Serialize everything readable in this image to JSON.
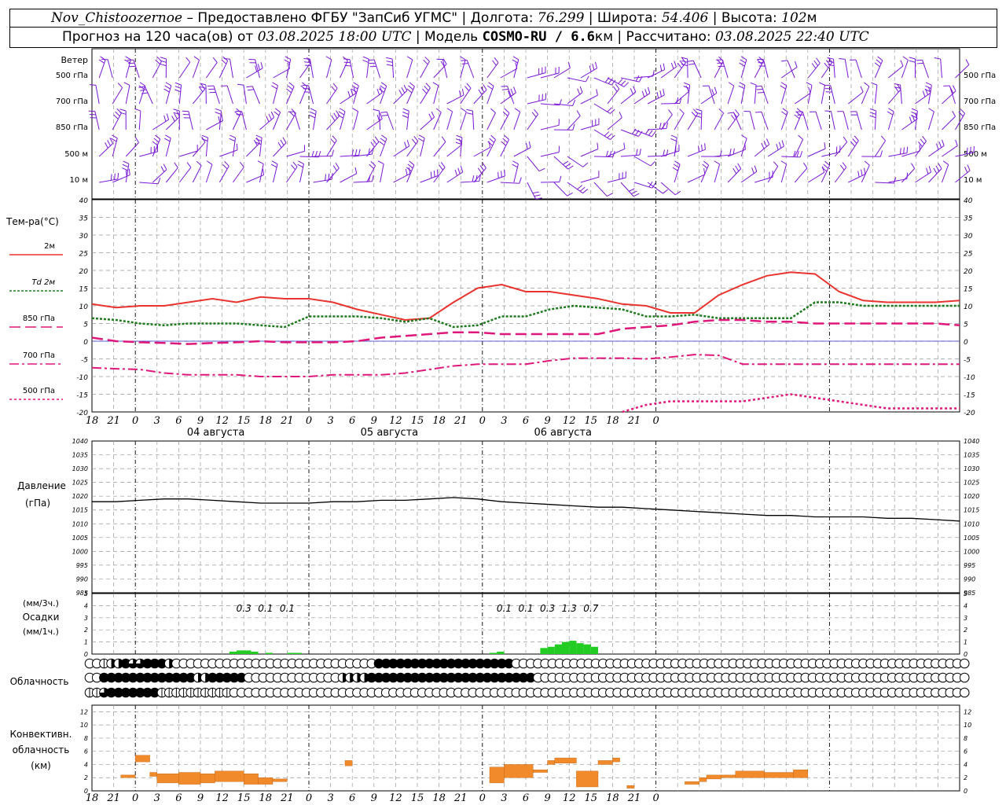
{
  "header": {
    "station": "Nov_Chistoozernoe",
    "provider": "– Предоставлено ФГБУ \"ЗапСиб УГМС\"",
    "lon_label": "| Долгота:",
    "lon_value": "76.299",
    "lat_label": "| Широта:",
    "lat_value": "54.406",
    "alt_label": "| Высота:",
    "alt_value": "102",
    "alt_unit": "м",
    "forecast_label": "Прогноз на 120 часа(ов) от",
    "forecast_start": "03.08.2025 18:00 UTC",
    "model_label": "| Модель",
    "model_name": "COSMO-RU / 6.6",
    "model_unit": "км",
    "calc_label": "| Рассчитано:",
    "calc_time": "03.08.2025 22:40 UTC"
  },
  "colors": {
    "wind": "#7a18d6",
    "t2m": "#e8332e",
    "td2m": "#1f7a1f",
    "t850": "#e0177a",
    "pressure": "#000000",
    "precip": "#22cc22",
    "conv": "#f08a2a"
  },
  "chart_data": [
    {
      "type": "wind_barbs",
      "panel_label": "Ветер",
      "levels": [
        "500 гПа",
        "700 гПа",
        "850 гПа",
        "500 м",
        "10  м"
      ],
      "x_time_labels": [
        "18",
        "21",
        "0",
        "3",
        "6",
        "9",
        "12",
        "15",
        "18",
        "21",
        "0",
        "3",
        "6",
        "9",
        "12",
        "15",
        "18",
        "21",
        "0",
        "3",
        "6",
        "9",
        "12",
        "15",
        "18",
        "21",
        "0"
      ]
    },
    {
      "type": "line",
      "title": "Тем-ра(°C)",
      "ylim": [
        -20,
        40
      ],
      "y_ticks": [
        "40",
        "35",
        "30",
        "25",
        "20",
        "15",
        "10",
        "5",
        "0",
        "-5",
        "-10",
        "-15",
        "-20"
      ],
      "x_labels": [
        "18",
        "21",
        "0",
        "3",
        "6",
        "9",
        "12",
        "15",
        "18",
        "21",
        "0",
        "3",
        "6",
        "9",
        "12",
        "15",
        "18",
        "21",
        "0",
        "3",
        "6",
        "9",
        "12",
        "15",
        "18",
        "21",
        "0"
      ],
      "date_labels": [
        "04 августа",
        "05 августа",
        "06 августа"
      ],
      "x_hours_step": 3,
      "series": [
        {
          "name": "2м",
          "key": "t2m",
          "values": [
            10.5,
            9.5,
            10,
            10,
            11,
            12,
            11,
            12.5,
            12,
            12,
            11,
            9,
            7.5,
            6,
            6.5,
            11,
            15,
            16,
            14,
            14,
            13,
            12,
            10.5,
            10,
            8,
            8,
            13,
            16,
            18.5,
            19.5,
            19,
            14,
            11.5,
            11,
            11,
            11,
            11.5
          ]
        },
        {
          "name": "Td 2м",
          "key": "td2m",
          "values": [
            6.5,
            6,
            5,
            4.5,
            5,
            5,
            5,
            4.5,
            4,
            7,
            7,
            7,
            6.5,
            5.5,
            6.5,
            4,
            4.5,
            7,
            7,
            9,
            10,
            9.5,
            9,
            7,
            7,
            7.5,
            6.5,
            6.5,
            6.5,
            6.5,
            11,
            11,
            10,
            10,
            10,
            10,
            10
          ]
        },
        {
          "name": "850 гПа",
          "key": "t850",
          "values": [
            1,
            0,
            -0.3,
            -0.5,
            -0.8,
            -0.5,
            -0.3,
            0,
            -0.3,
            -0.3,
            -0.3,
            0,
            1,
            1.5,
            2,
            2.5,
            2.5,
            2,
            2,
            2,
            2,
            2,
            3.5,
            4,
            4.5,
            5.5,
            6,
            6,
            5.5,
            5.5,
            5,
            5,
            5,
            5,
            5,
            5,
            4.5
          ]
        },
        {
          "name": "700 гПа",
          "key": "t700",
          "values": [
            -7.5,
            -7.8,
            -8,
            -9,
            -9.5,
            -9.5,
            -9.5,
            -10,
            -10,
            -10,
            -9.5,
            -9.5,
            -9.5,
            -9,
            -8,
            -7,
            -6.5,
            -6.5,
            -6.5,
            -5.5,
            -4.8,
            -4.8,
            -4.8,
            -5,
            -4.5,
            -3.8,
            -4,
            -6.5,
            -6.5,
            -6.5,
            -6.5,
            -6.5,
            -6.5,
            -6.5,
            -6.5,
            -6.5,
            -6.5
          ]
        },
        {
          "name": "500 гПа",
          "key": "t500",
          "values": [
            null,
            null,
            null,
            null,
            null,
            null,
            null,
            null,
            null,
            null,
            null,
            null,
            null,
            null,
            null,
            null,
            null,
            null,
            null,
            null,
            null,
            null,
            -20,
            -18,
            -17,
            -17,
            -17,
            -17,
            -16,
            -15,
            -16,
            -17,
            -18,
            -19,
            -19,
            -19,
            -19
          ]
        }
      ]
    },
    {
      "type": "line",
      "title": "Давление",
      "ylabel": "(гПа)",
      "ylim": [
        985,
        1040
      ],
      "y_ticks": [
        "1040",
        "1035",
        "1030",
        "1025",
        "1020",
        "1015",
        "1010",
        "1005",
        "1000",
        "995",
        "990",
        "985"
      ],
      "x_hours_step": 3,
      "series": [
        {
          "name": "Давление",
          "key": "pressure",
          "values": [
            1018,
            1018,
            1018.5,
            1019,
            1019,
            1018.5,
            1018,
            1017.5,
            1017.5,
            1017.5,
            1018,
            1018,
            1018.5,
            1018.5,
            1019,
            1019.5,
            1019,
            1018,
            1017.5,
            1017,
            1016.5,
            1016,
            1016,
            1015.5,
            1015,
            1014.5,
            1014,
            1013.5,
            1013,
            1013,
            1012.5,
            1012.5,
            1012.5,
            1012,
            1012,
            1011.5,
            1011
          ]
        }
      ]
    },
    {
      "type": "bar",
      "title": "Осадки",
      "ylabel_top": "(мм/3ч.)",
      "ylabel_bottom": "(мм/1ч.)",
      "ylim": [
        0,
        5
      ],
      "y_ticks": [
        "5",
        "4",
        "3",
        "2",
        "1",
        "0"
      ],
      "annotations": [
        {
          "hour": 21,
          "text": "0.3"
        },
        {
          "hour": 24,
          "text": "0.1"
        },
        {
          "hour": 27,
          "text": "0.1"
        },
        {
          "hour": 57,
          "text": "0.1"
        },
        {
          "hour": 60,
          "text": "0.1"
        },
        {
          "hour": 63,
          "text": "0.3"
        },
        {
          "hour": 66,
          "text": "1.3"
        },
        {
          "hour": 69,
          "text": "0.7"
        }
      ],
      "hourly_bars": [
        {
          "hour": 20,
          "value": 0.2
        },
        {
          "hour": 21,
          "value": 0.3
        },
        {
          "hour": 22,
          "value": 0.3
        },
        {
          "hour": 23,
          "value": 0.2
        },
        {
          "hour": 25,
          "value": 0.1
        },
        {
          "hour": 28,
          "value": 0.1
        },
        {
          "hour": 29,
          "value": 0.1
        },
        {
          "hour": 56,
          "value": 0.1
        },
        {
          "hour": 57,
          "value": 0.2
        },
        {
          "hour": 63,
          "value": 0.5
        },
        {
          "hour": 64,
          "value": 0.6
        },
        {
          "hour": 65,
          "value": 0.8
        },
        {
          "hour": 66,
          "value": 1.0
        },
        {
          "hour": 67,
          "value": 1.1
        },
        {
          "hour": 68,
          "value": 0.9
        },
        {
          "hour": 69,
          "value": 0.8
        },
        {
          "hour": 70,
          "value": 0.6
        }
      ]
    },
    {
      "type": "symbols",
      "title": "Облачность",
      "rows": [
        "00122433444200000000000000000000000000004444444444444444444000000000000000000000000000000000000000000000000000000000000000",
        "00444444444444422444440000000000000222244444444444444444444444000000000000000000000000000000000000000000000000000000000000",
        "11344444441111111111000000000000000000000000000000000000000000000000000000000000000000000000000000000000000000000000000000"
      ]
    },
    {
      "type": "bar",
      "title": "Конвективн. облачность (км)",
      "ylim": [
        0,
        13
      ],
      "y_ticks": [
        "12",
        "10",
        "8",
        "6",
        "4",
        "2",
        "0"
      ],
      "segments": [
        {
          "from": 4,
          "to": 6,
          "low": 2,
          "high": 2.4
        },
        {
          "from": 6,
          "to": 8,
          "low": 4.4,
          "high": 5.4
        },
        {
          "from": 8,
          "to": 9,
          "low": 2.2,
          "high": 2.8
        },
        {
          "from": 9,
          "to": 12,
          "low": 1.2,
          "high": 2.6
        },
        {
          "from": 12,
          "to": 15,
          "low": 1.0,
          "high": 2.8
        },
        {
          "from": 15,
          "to": 17,
          "low": 1.2,
          "high": 2.6
        },
        {
          "from": 17,
          "to": 21,
          "low": 1.4,
          "high": 3.0
        },
        {
          "from": 21,
          "to": 23,
          "low": 1.0,
          "high": 2.6
        },
        {
          "from": 23,
          "to": 25,
          "low": 1.0,
          "high": 2.0
        },
        {
          "from": 25,
          "to": 27,
          "low": 1.4,
          "high": 1.8
        },
        {
          "from": 35,
          "to": 36,
          "low": 3.8,
          "high": 4.6
        },
        {
          "from": 55,
          "to": 57,
          "low": 1.2,
          "high": 3.6
        },
        {
          "from": 57,
          "to": 61,
          "low": 2.0,
          "high": 4.0
        },
        {
          "from": 61,
          "to": 63,
          "low": 2.8,
          "high": 3.2
        },
        {
          "from": 63,
          "to": 64,
          "low": 4.0,
          "high": 4.6
        },
        {
          "from": 64,
          "to": 67,
          "low": 4.2,
          "high": 5.0
        },
        {
          "from": 67,
          "to": 70,
          "low": 0.6,
          "high": 3.0
        },
        {
          "from": 70,
          "to": 72,
          "low": 4.0,
          "high": 4.6
        },
        {
          "from": 72,
          "to": 73,
          "low": 4.4,
          "high": 5.0
        },
        {
          "from": 74,
          "to": 75,
          "low": 0.4,
          "high": 0.8
        },
        {
          "from": 82,
          "to": 84,
          "low": 1.0,
          "high": 1.4
        },
        {
          "from": 84,
          "to": 85,
          "low": 1.4,
          "high": 2.0
        },
        {
          "from": 85,
          "to": 87,
          "low": 1.8,
          "high": 2.4
        },
        {
          "from": 87,
          "to": 89,
          "low": 2.0,
          "high": 2.4
        },
        {
          "from": 89,
          "to": 93,
          "low": 2.0,
          "high": 3.0
        },
        {
          "from": 93,
          "to": 97,
          "low": 2.0,
          "high": 2.8
        },
        {
          "from": 97,
          "to": 99,
          "low": 2.0,
          "high": 3.2
        }
      ]
    }
  ]
}
